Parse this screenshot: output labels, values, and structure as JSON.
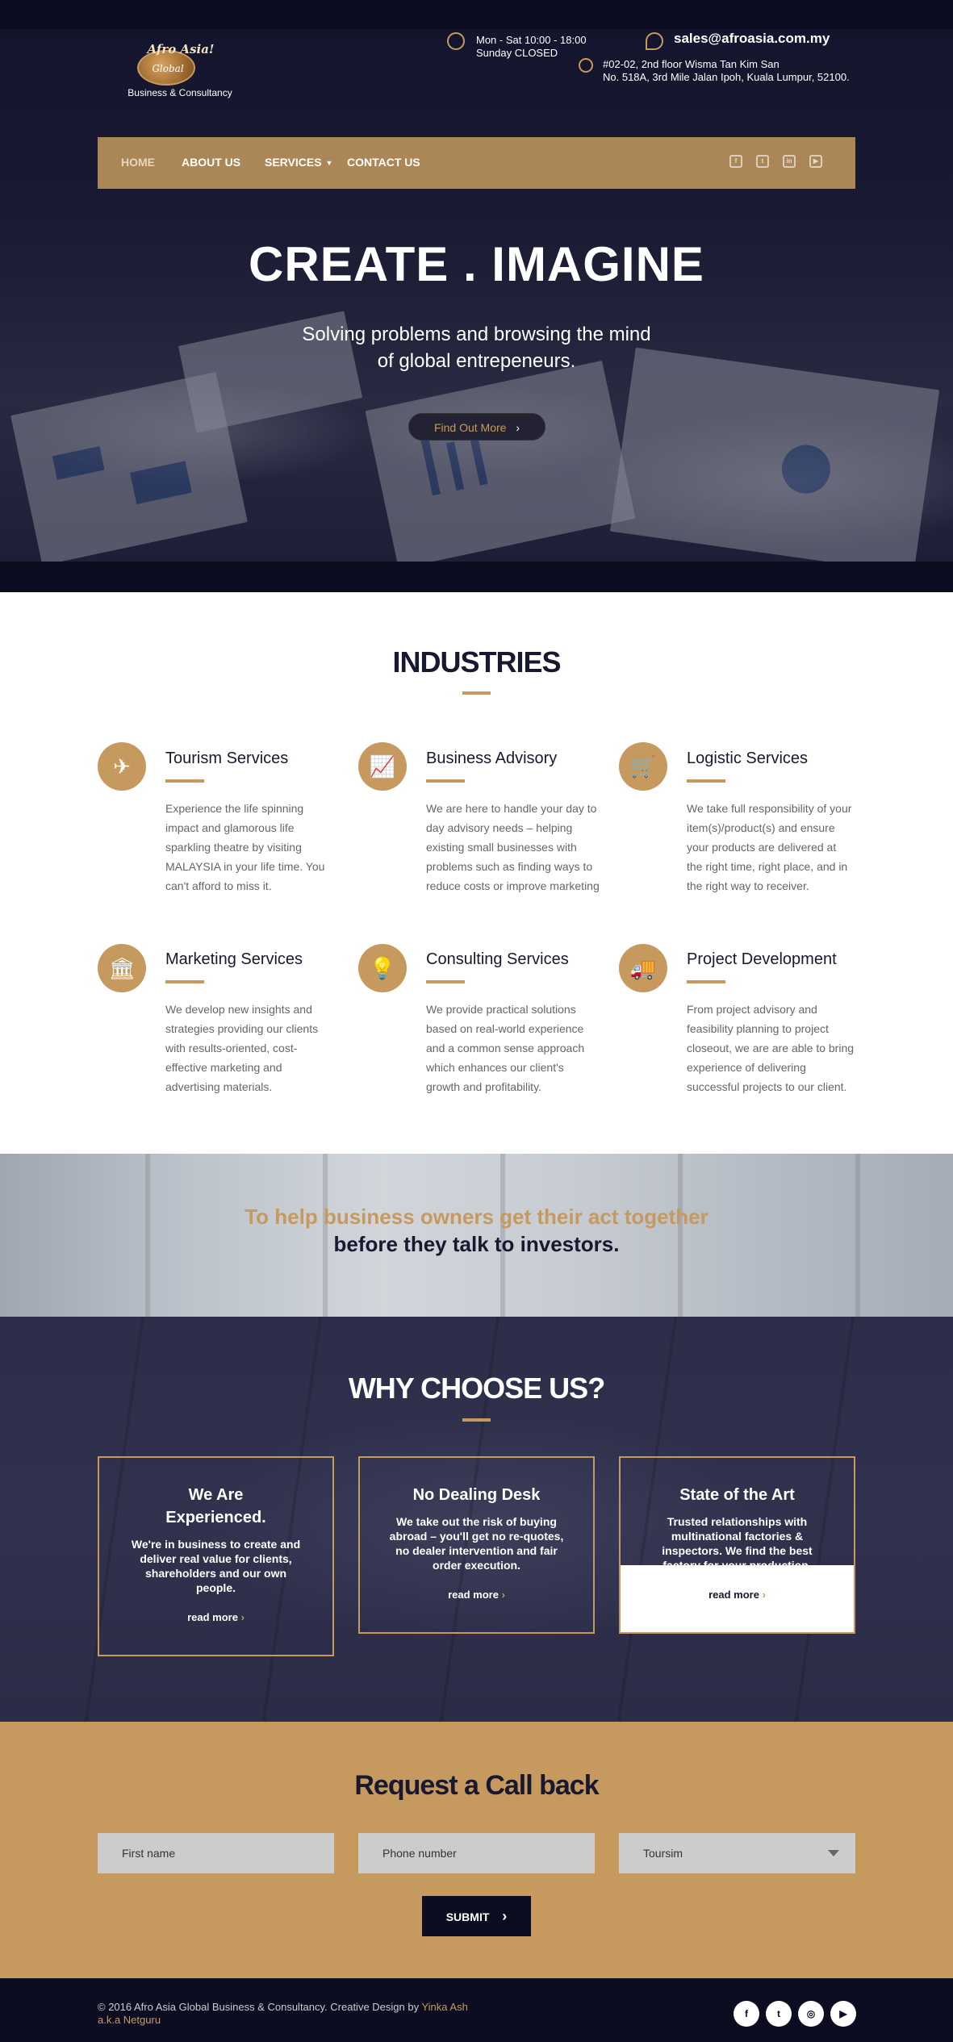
{
  "header": {
    "logo": {
      "line1": "Afro Asia!",
      "line2": "Global",
      "line3": "Business & Consultancy"
    },
    "hours": {
      "line1": "Mon - Sat 10:00 - 18:00",
      "line2": "Sunday CLOSED"
    },
    "email": "sales@afroasia.com.my",
    "address": {
      "line1": "#02-02, 2nd floor Wisma Tan Kim San",
      "line2": "No. 518A, 3rd Mile Jalan Ipoh, Kuala Lumpur, 52100."
    }
  },
  "nav": {
    "items": [
      {
        "label": "HOME"
      },
      {
        "label": "ABOUT US"
      },
      {
        "label": "SERVICES"
      },
      {
        "label": "CONTACT US"
      }
    ],
    "social": [
      "facebook-icon",
      "twitter-icon",
      "linkedin-icon",
      "youtube-icon"
    ]
  },
  "hero": {
    "title": "CREATE . IMAGINE",
    "subtitle_line1": "Solving problems and browsing the mind",
    "subtitle_line2": "of global entrepeneurs.",
    "cta": "Find Out More"
  },
  "industries": {
    "heading": "INDUSTRIES",
    "items": [
      {
        "icon": "plane-icon",
        "title": "Tourism Services",
        "text": "Experience the life spinning impact and glamorous life sparkling theatre by visiting MALAYSIA in your life time. You can't afford to miss it."
      },
      {
        "icon": "chart-icon",
        "title": "Business Advisory",
        "text": "We are here to handle your day to day advisory needs – helping existing small businesses with problems such as finding ways to reduce costs or improve marketing"
      },
      {
        "icon": "cart-icon",
        "title": "Logistic Services",
        "text": "We take full responsibility of your item(s)/product(s) and ensure your products are delivered at the right time, right place, and in the right way to receiver."
      },
      {
        "icon": "bank-icon",
        "title": "Marketing Services",
        "text": "We develop new insights and strategies providing our clients with results-oriented, cost-effective marketing and advertising materials."
      },
      {
        "icon": "bulb-icon",
        "title": "Consulting Services",
        "text": "We provide practical solutions based on real-world experience and a common sense approach which enhances our client's growth and profitability."
      },
      {
        "icon": "truck-icon",
        "title": "Project Development",
        "text": "From project advisory and feasibility planning to project closeout, we are are able to bring experience of delivering successful projects to our client."
      }
    ]
  },
  "quote": {
    "line1": "To help business owners get their act together",
    "line2": "before they talk to investors."
  },
  "why": {
    "heading": "WHY CHOOSE US?",
    "cards": [
      {
        "title": "We Are Experienced.",
        "text": "We're in business to create and deliver real value for clients, shareholders and our own people.",
        "link": "read more"
      },
      {
        "title": "No Dealing Desk",
        "text": "We take out the risk of buying abroad – you'll get no re-quotes, no dealer intervention and fair order execution.",
        "link": "read more"
      },
      {
        "title": "State of the Art",
        "text": "Trusted relationships with multinational factories & inspectors. We find the best factory for your production.",
        "link": "read more"
      }
    ]
  },
  "callback": {
    "heading": "Request a Call back",
    "first_name_placeholder": "First name",
    "phone_placeholder": "Phone number",
    "service_selected": "Toursim",
    "submit": "SUBMIT"
  },
  "footer": {
    "copyright": "© 2016 Afro Asia Global Business & Consultancy. Creative Design by ",
    "designer": "Yinka Ash a.k.a Netguru",
    "social": [
      "facebook-icon",
      "twitter-icon",
      "instagram-icon",
      "youtube-icon"
    ]
  },
  "colors": {
    "gold": "#c69a5e",
    "navy": "#0d0d22",
    "dark_text": "#181830"
  }
}
